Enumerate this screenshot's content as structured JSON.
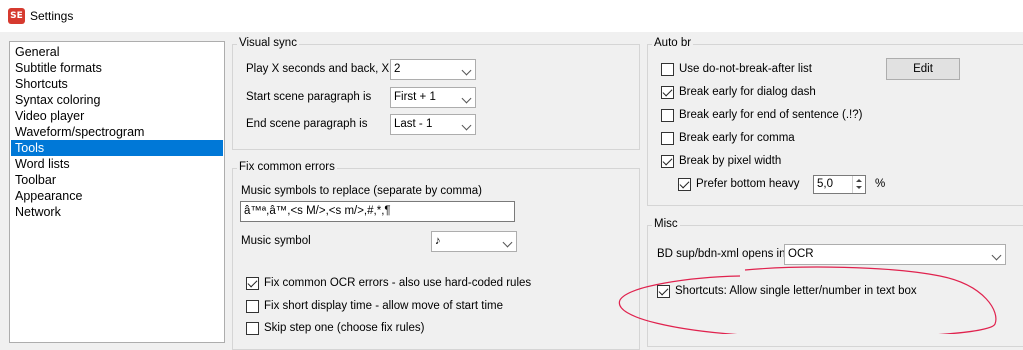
{
  "window": {
    "title": "Settings",
    "icon": "subtitle-edit-logo-icon",
    "icon_text": "SE",
    "accent": "#d63a2f"
  },
  "nav": {
    "items": [
      "General",
      "Subtitle formats",
      "Shortcuts",
      "Syntax coloring",
      "Video player",
      "Waveform/spectrogram",
      "Tools",
      "Word lists",
      "Toolbar",
      "Appearance",
      "Network"
    ],
    "selected": "Tools",
    "selected_color": "#0078d7"
  },
  "visual_sync": {
    "title": "Visual sync",
    "play_label": "Play X seconds and back, X is",
    "play_value": "2",
    "start_label": "Start scene paragraph is",
    "start_value": "First + 1",
    "end_label": "End scene paragraph is",
    "end_value": "Last - 1"
  },
  "fix_common_errors": {
    "title": "Fix common errors",
    "music_replace_label": "Music symbols to replace (separate by comma)",
    "music_replace_value": "â™ª,â™,<s M/>,<s m/>,#,*,¶",
    "music_symbol_label": "Music symbol",
    "music_symbol_value": "♪",
    "checks": [
      {
        "label": "Fix common OCR errors - also use hard-coded rules",
        "checked": true
      },
      {
        "label": "Fix short display time - allow move of start time",
        "checked": false
      },
      {
        "label": "Skip step one (choose fix rules)",
        "checked": false
      }
    ]
  },
  "auto_br": {
    "title": "Auto br",
    "edit_label": "Edit",
    "checks": [
      {
        "label": "Use do-not-break-after list",
        "checked": false
      },
      {
        "label": "Break early for dialog dash",
        "checked": true
      },
      {
        "label": "Break early for end of sentence (.!?)",
        "checked": false
      },
      {
        "label": "Break early for comma",
        "checked": false
      },
      {
        "label": "Break by pixel width",
        "checked": true
      }
    ],
    "prefer_bottom_heavy": {
      "label": "Prefer bottom heavy",
      "checked": true,
      "value": "5,0",
      "unit": "%"
    }
  },
  "misc": {
    "title": "Misc",
    "bdn_label": "BD sup/bdn-xml opens in",
    "bdn_value": "OCR",
    "shortcuts_check": {
      "label": "Shortcuts: Allow single letter/number in text box",
      "checked": true
    }
  },
  "annotation": {
    "color": "#e0224e"
  }
}
